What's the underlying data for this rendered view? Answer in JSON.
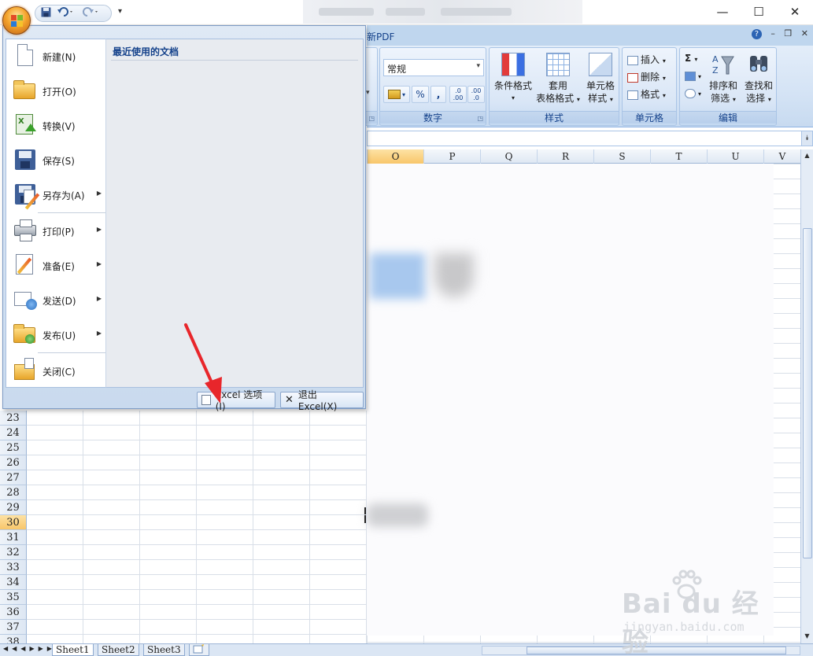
{
  "window": {
    "minimize": "—",
    "maximize": "☐",
    "close": "✕"
  },
  "qat": {
    "dropdown_glyph": "▾"
  },
  "ribbon": {
    "tab_partial": "新PDF",
    "number_format": "常规",
    "percent": "%",
    "comma": ",",
    "increase_decimal": ".0 .00",
    "decrease_decimal": ".00 .0",
    "group_number": "数字",
    "group_styles": "样式",
    "group_cells": "单元格",
    "group_edit": "编辑",
    "conditional_format": "条件格式",
    "table_format_1": "套用",
    "table_format_2": "表格格式",
    "cell_style_1": "单元格",
    "cell_style_2": "样式",
    "insert": "插入",
    "delete": "删除",
    "format": "格式",
    "sigma": "Σ",
    "sort_filter_1": "排序和",
    "sort_filter_2": "筛选",
    "find_select_1": "查找和",
    "find_select_2": "选择"
  },
  "columns": [
    "O",
    "P",
    "Q",
    "R",
    "S",
    "T",
    "U",
    "V"
  ],
  "selected_column": "O",
  "rows": [
    "23",
    "24",
    "25",
    "26",
    "27",
    "28",
    "29",
    "30",
    "31",
    "32",
    "33",
    "34",
    "35",
    "36",
    "37",
    "38"
  ],
  "selected_row": "30",
  "office_menu": {
    "recent_title": "最近使用的文档",
    "items": [
      {
        "label": "新建(N)"
      },
      {
        "label": "打开(O)"
      },
      {
        "label": "转换(V)"
      },
      {
        "label": "保存(S)"
      },
      {
        "label": "另存为(A)"
      },
      {
        "label": "打印(P)"
      },
      {
        "label": "准备(E)"
      },
      {
        "label": "发送(D)"
      },
      {
        "label": "发布(U)"
      },
      {
        "label": "关闭(C)"
      }
    ],
    "options_button": "Excel 选项(I)",
    "exit_button": "退出 Excel(X)"
  },
  "sheets": [
    "Sheet1",
    "Sheet2",
    "Sheet3"
  ],
  "active_sheet": "Sheet1",
  "watermark": {
    "brand": "Bai du 经验",
    "url": "jingyan.baidu.com"
  },
  "colors": {
    "accent": "#15428b",
    "annotation": "#e8262b",
    "selected_header": "#f8c66a"
  }
}
